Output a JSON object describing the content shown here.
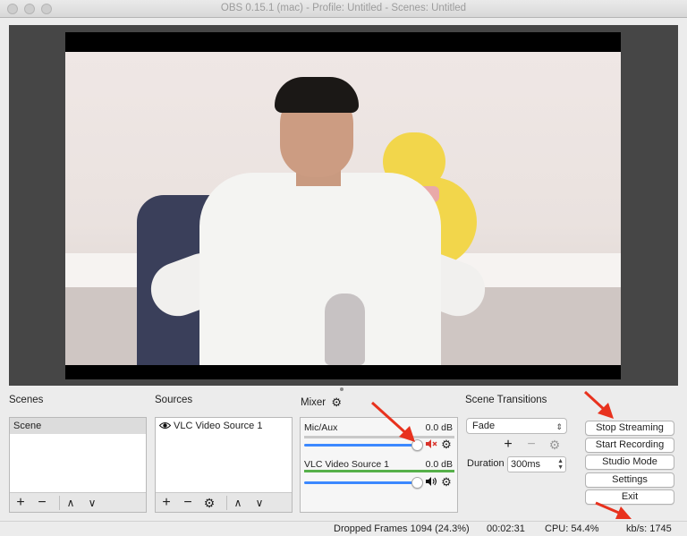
{
  "window": {
    "title": "OBS 0.15.1 (mac) - Profile: Untitled - Scenes: Untitled"
  },
  "docks": {
    "scenes": {
      "title": "Scenes",
      "items": [
        "Scene"
      ]
    },
    "sources": {
      "title": "Sources",
      "items": [
        "VLC Video Source 1"
      ]
    },
    "mixer": {
      "title": "Mixer",
      "channels": [
        {
          "name": "Mic/Aux",
          "db": "0.0 dB",
          "muted": true,
          "level": 1.0
        },
        {
          "name": "VLC Video Source 1",
          "db": "0.0 dB",
          "muted": false,
          "level": 1.0
        }
      ]
    },
    "transitions": {
      "title": "Scene Transitions",
      "selected": "Fade",
      "duration_label": "Duration",
      "duration_value": "300ms"
    }
  },
  "controls": {
    "stop_streaming": "Stop Streaming",
    "start_recording": "Start Recording",
    "studio_mode": "Studio Mode",
    "settings": "Settings",
    "exit": "Exit"
  },
  "status": {
    "dropped_frames": "Dropped Frames 1094 (24.3%)",
    "time": "00:02:31",
    "cpu": "CPU: 54.4%",
    "kbps": "kb/s: 1745"
  },
  "colors": {
    "accent": "#3b88ff",
    "annotation_arrow": "#e8321e",
    "mute_red": "#d9332b",
    "meter_green": "#56b04a"
  }
}
